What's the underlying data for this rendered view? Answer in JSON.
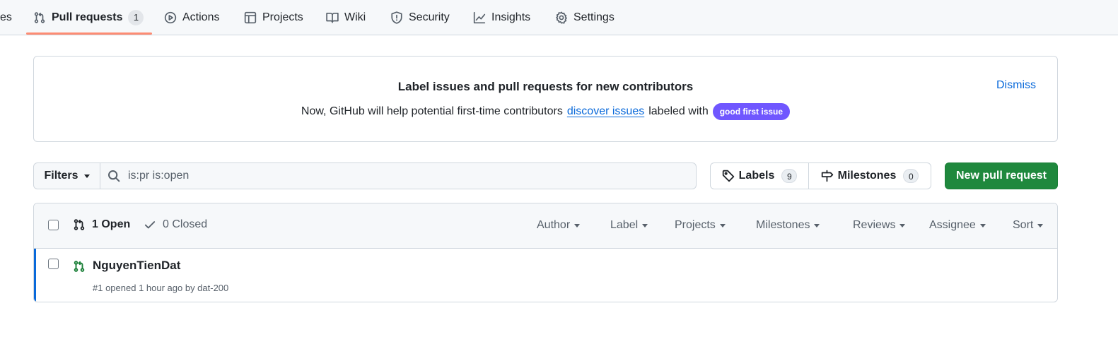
{
  "nav": {
    "partial_label": "es",
    "items": [
      {
        "id": "pull-requests",
        "label": "Pull requests",
        "counter": "1",
        "icon": "git-pull-request-icon",
        "selected": true
      },
      {
        "id": "actions",
        "label": "Actions",
        "icon": "play-icon"
      },
      {
        "id": "projects",
        "label": "Projects",
        "icon": "table-icon"
      },
      {
        "id": "wiki",
        "label": "Wiki",
        "icon": "book-icon"
      },
      {
        "id": "security",
        "label": "Security",
        "icon": "shield-icon"
      },
      {
        "id": "insights",
        "label": "Insights",
        "icon": "graph-icon"
      },
      {
        "id": "settings",
        "label": "Settings",
        "icon": "gear-icon"
      }
    ],
    "underline_color": "#fd8c73"
  },
  "banner": {
    "title": "Label issues and pull requests for new contributors",
    "text_before": "Now, GitHub will help potential first-time contributors",
    "link": "discover issues",
    "text_after": "labeled with",
    "label": "good first issue",
    "label_color": "#7057ff",
    "dismiss": "Dismiss"
  },
  "filterbar": {
    "filters_label": "Filters",
    "search_value": "is:pr is:open",
    "labels_label": "Labels",
    "labels_count": "9",
    "milestones_label": "Milestones",
    "milestones_count": "0",
    "new_pr_label": "New pull request",
    "new_pr_color": "#1f883d"
  },
  "list": {
    "open_label": "1 Open",
    "closed_label": "0 Closed",
    "filters": [
      "Author",
      "Label",
      "Projects",
      "Milestones",
      "Reviews",
      "Assignee",
      "Sort"
    ],
    "rows": [
      {
        "title": "NguyenTienDat",
        "meta": "#1 opened 1 hour ago by dat-200"
      }
    ]
  }
}
